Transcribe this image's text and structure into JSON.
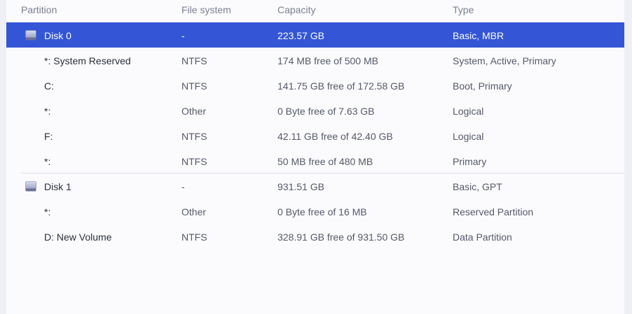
{
  "columns": {
    "partition": "Partition",
    "file_system": "File system",
    "capacity": "Capacity",
    "type": "Type"
  },
  "rows": [
    {
      "kind": "disk",
      "partition": "Disk 0",
      "file_system": "-",
      "capacity": "223.57 GB",
      "type": "Basic, MBR",
      "selected": true
    },
    {
      "kind": "partition",
      "partition": "*: System Reserved",
      "file_system": "NTFS",
      "capacity": "174 MB free of 500 MB",
      "type": "System, Active, Primary"
    },
    {
      "kind": "partition",
      "partition": "C:",
      "file_system": "NTFS",
      "capacity": "141.75 GB free of 172.58 GB",
      "type": "Boot, Primary"
    },
    {
      "kind": "partition",
      "partition": "*:",
      "file_system": "Other",
      "capacity": "0 Byte free of 7.63 GB",
      "type": "Logical"
    },
    {
      "kind": "partition",
      "partition": "F:",
      "file_system": "NTFS",
      "capacity": "42.11 GB free of 42.40 GB",
      "type": "Logical"
    },
    {
      "kind": "partition",
      "partition": "*:",
      "file_system": "NTFS",
      "capacity": "50 MB free of 480 MB",
      "type": "Primary"
    },
    {
      "kind": "disk",
      "partition": "Disk 1",
      "file_system": "-",
      "capacity": "931.51 GB",
      "type": "Basic, GPT",
      "selected": false
    },
    {
      "kind": "partition",
      "partition": "*:",
      "file_system": "Other",
      "capacity": "0 Byte free of 16 MB",
      "type": "Reserved Partition"
    },
    {
      "kind": "partition",
      "partition": "D: New Volume",
      "file_system": "NTFS",
      "capacity": "328.91 GB free of 931.50 GB",
      "type": "Data Partition"
    }
  ],
  "icons": {
    "disk": "hard-disk-icon"
  },
  "colors": {
    "selection": "#3355d6",
    "header_text": "#7b8091"
  }
}
